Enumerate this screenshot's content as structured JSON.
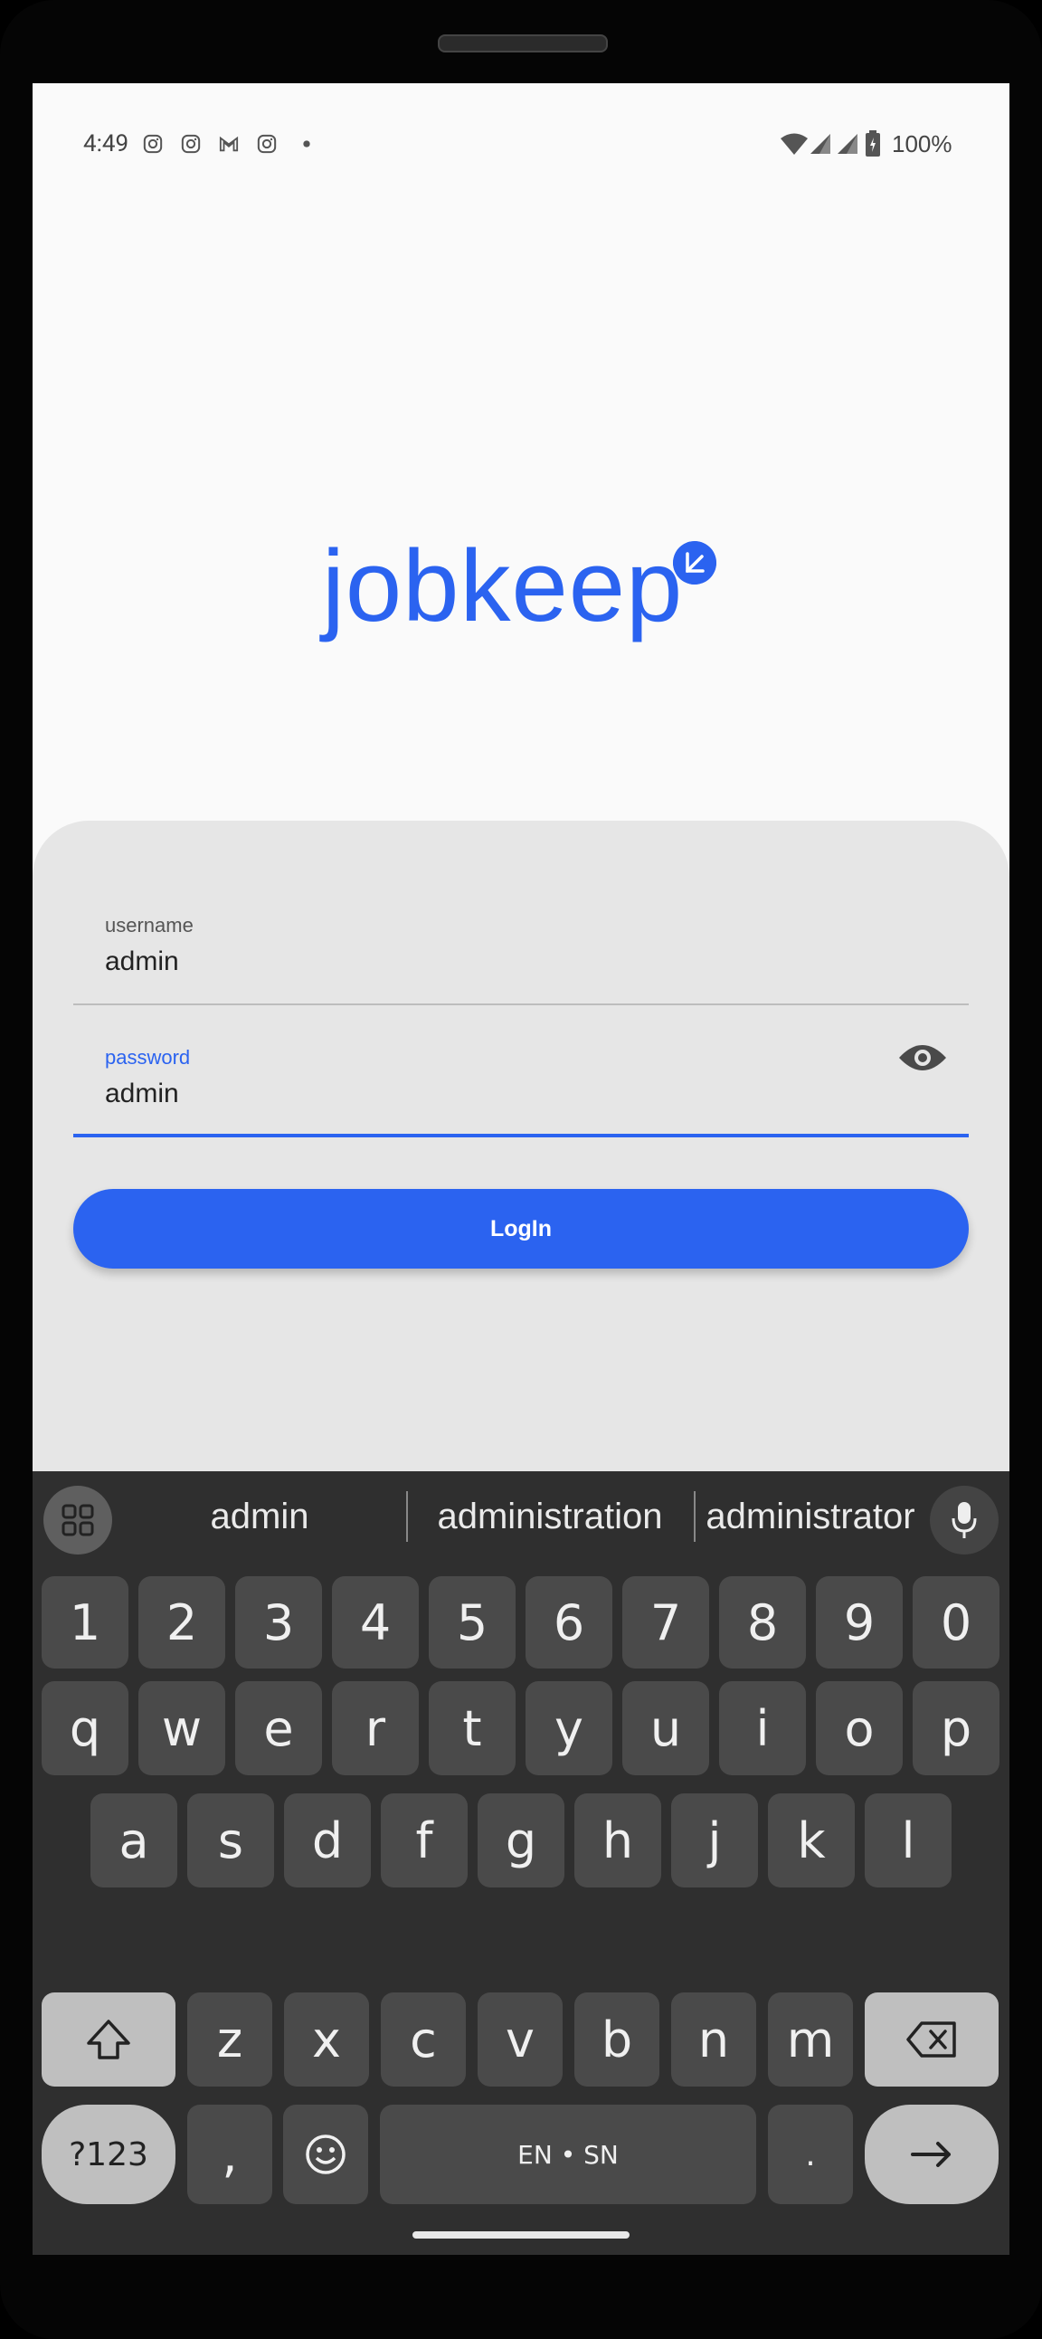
{
  "status_bar": {
    "time": "4:49",
    "battery": "100%"
  },
  "logo": {
    "text": "jobkeep"
  },
  "form": {
    "username_label": "username",
    "username_value": "admin",
    "password_label": "password",
    "password_value": "admin",
    "login_label": "LogIn"
  },
  "keyboard": {
    "suggestions": [
      "admin",
      "administration",
      "administrator"
    ],
    "row_numbers": [
      "1",
      "2",
      "3",
      "4",
      "5",
      "6",
      "7",
      "8",
      "9",
      "0"
    ],
    "row_top": [
      "q",
      "w",
      "e",
      "r",
      "t",
      "y",
      "u",
      "i",
      "o",
      "p"
    ],
    "row_mid": [
      "a",
      "s",
      "d",
      "f",
      "g",
      "h",
      "j",
      "k",
      "l"
    ],
    "row_bot": [
      "z",
      "x",
      "c",
      "v",
      "b",
      "n",
      "m"
    ],
    "symbols_label": "?123",
    "comma_label": ",",
    "space_label": "EN • SN",
    "period_label": "."
  },
  "colors": {
    "accent": "#2b63f0",
    "card_bg": "#e6e6e6",
    "keyboard_bg": "#2f2f2f"
  }
}
